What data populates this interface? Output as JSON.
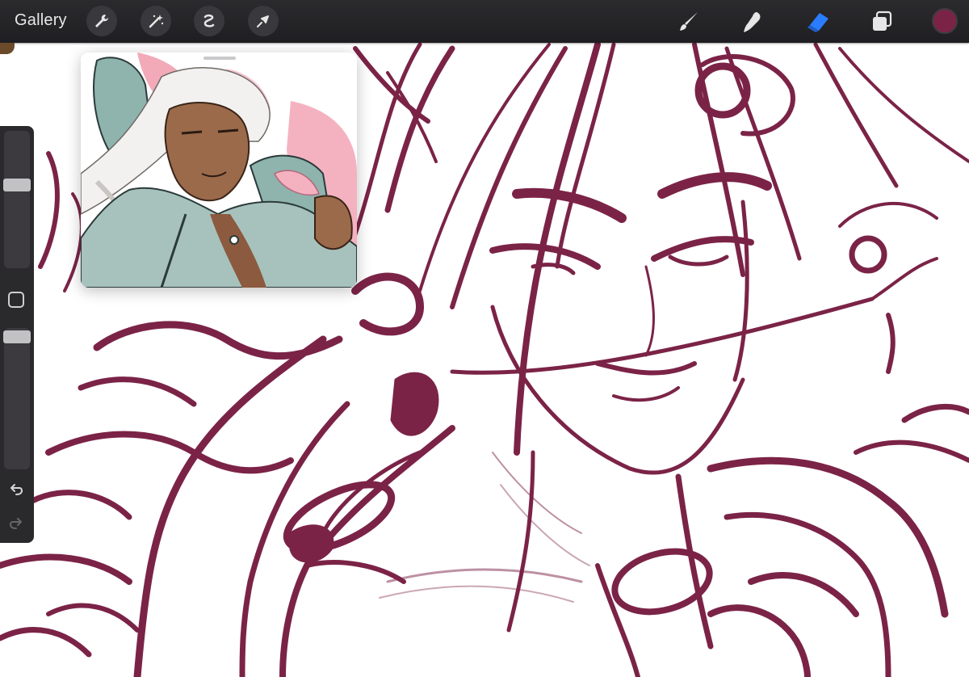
{
  "toolbar": {
    "gallery_label": "Gallery",
    "left_tools": [
      "wrench-icon",
      "magic-wand-icon",
      "selection-icon",
      "transform-arrow-icon"
    ],
    "right_tools": [
      "brush-icon",
      "smudge-icon",
      "eraser-icon",
      "layers-icon"
    ],
    "active_tool": "eraser-icon",
    "active_color": "#7b2347",
    "accent_color": "#2a7dff"
  },
  "sidebar": {
    "brush_size_level": 0.62,
    "brush_opacity_level": 0.98,
    "buttons": [
      "modify-square-icon",
      "undo-icon",
      "redo-icon"
    ]
  },
  "reference": {
    "visible": true
  },
  "canvas": {
    "background": "#ffffff",
    "stroke_color": "#7b2347"
  }
}
